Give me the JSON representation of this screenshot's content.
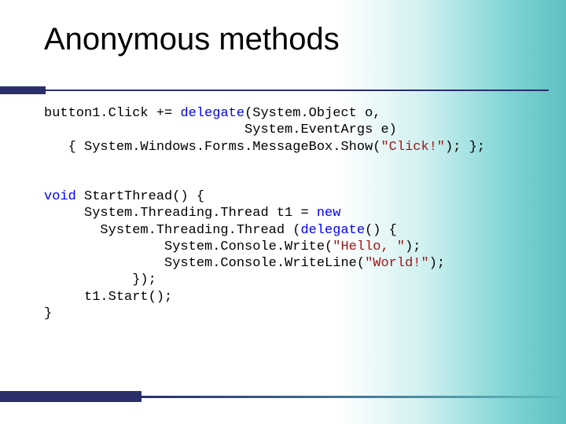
{
  "title": "Anonymous methods",
  "code1": {
    "t1a": "button1.Click += ",
    "kw1": "delegate",
    "t1b": "(System.Object o,",
    "t2": "                         System.EventArgs e)",
    "t3a": "   { System.Windows.Forms.MessageBox.Show(",
    "s3": "\"Click!\"",
    "t3b": "); };"
  },
  "code2": {
    "kw1": "void",
    "t1": " StartThread() {",
    "t2a": "     System.Threading.Thread t1 = ",
    "kw2": "new",
    "t3a": "       System.Threading.Thread (",
    "kw3": "delegate",
    "t3b": "() {",
    "t4a": "               System.Console.Write(",
    "s4": "\"Hello, \"",
    "t4b": ");",
    "t5a": "               System.Console.WriteLine(",
    "s5": "\"World!\"",
    "t5b": ");",
    "t6": "           });",
    "t7": "     t1.Start();",
    "t8": "}"
  }
}
